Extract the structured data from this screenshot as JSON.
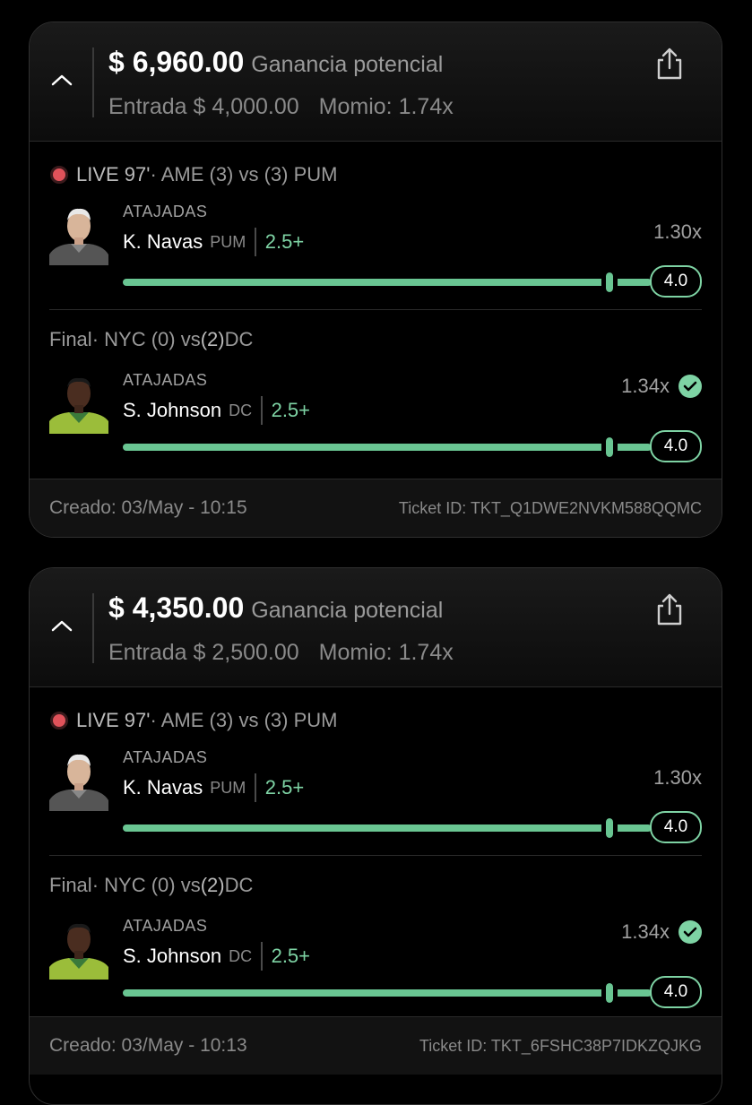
{
  "tickets": [
    {
      "payout": "$ 6,960.00",
      "payout_label": "Ganancia potencial",
      "entry": "Entrada $ 4,000.00",
      "odds": "Momio: 1.74x",
      "created": "Creado: 03/May - 10:15",
      "ticket_id": "Ticket ID: TKT_Q1DWE2NVKM588QQMC",
      "legs": [
        {
          "status": "LIVE 97'",
          "match_pre": " · AME (3) vs (3) PUM",
          "stat": "ATAJADAS",
          "player": "K. Navas",
          "team": "PUM",
          "line": "2.5+",
          "multiplier": "1.30x",
          "target": "4.0",
          "progress": 0.92,
          "won": false
        },
        {
          "status": "Final",
          "match_pre": " · NYC (0) vs ",
          "match_strong": "(2)",
          "match_post": " DC",
          "stat": "ATAJADAS",
          "player": "S. Johnson",
          "team": "DC",
          "line": "2.5+",
          "multiplier": "1.34x",
          "target": "4.0",
          "progress": 0.92,
          "won": true
        }
      ]
    },
    {
      "payout": "$ 4,350.00",
      "payout_label": "Ganancia potencial",
      "entry": "Entrada $ 2,500.00",
      "odds": "Momio: 1.74x",
      "created": "Creado: 03/May - 10:13",
      "ticket_id": "Ticket ID: TKT_6FSHC38P7IDKZQJKG",
      "legs": [
        {
          "status": "LIVE 97'",
          "match_pre": " · AME (3) vs (3) PUM",
          "stat": "ATAJADAS",
          "player": "K. Navas",
          "team": "PUM",
          "line": "2.5+",
          "multiplier": "1.30x",
          "target": "4.0",
          "progress": 0.92,
          "won": false
        },
        {
          "status": "Final",
          "match_pre": " · NYC (0) vs ",
          "match_strong": "(2)",
          "match_post": " DC",
          "stat": "ATAJADAS",
          "player": "S. Johnson",
          "team": "DC",
          "line": "2.5+",
          "multiplier": "1.34x",
          "target": "4.0",
          "progress": 0.92,
          "won": true
        }
      ]
    }
  ],
  "colors": {
    "accent": "#7ed3a4",
    "live": "#e0525a",
    "background": "#000000"
  },
  "icons": {
    "collapse": "chevron-up-icon",
    "share": "share-icon",
    "check": "check-circle-icon"
  }
}
